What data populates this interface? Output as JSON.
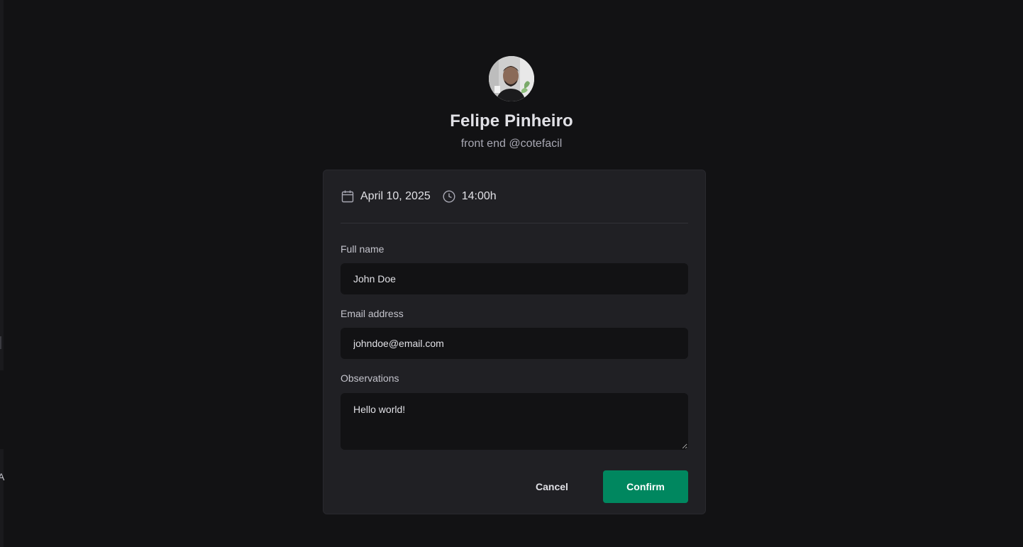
{
  "profile": {
    "name": "Felipe Pinheiro",
    "role": "front end @cotefacil"
  },
  "schedule": {
    "date": "April 10, 2025",
    "time": "14:00h",
    "date_icon": "calendar-icon",
    "time_icon": "clock-icon"
  },
  "form": {
    "full_name": {
      "label": "Full name",
      "value": "John Doe"
    },
    "email": {
      "label": "Email address",
      "value": "johndoe@email.com"
    },
    "observations": {
      "label": "Observations",
      "value": "Hello world!"
    }
  },
  "actions": {
    "cancel_label": "Cancel",
    "confirm_label": "Confirm"
  },
  "colors": {
    "background": "#121214",
    "card": "#202024",
    "input": "#121214",
    "accent": "#00875f"
  },
  "edge": {
    "glyph": "A"
  }
}
